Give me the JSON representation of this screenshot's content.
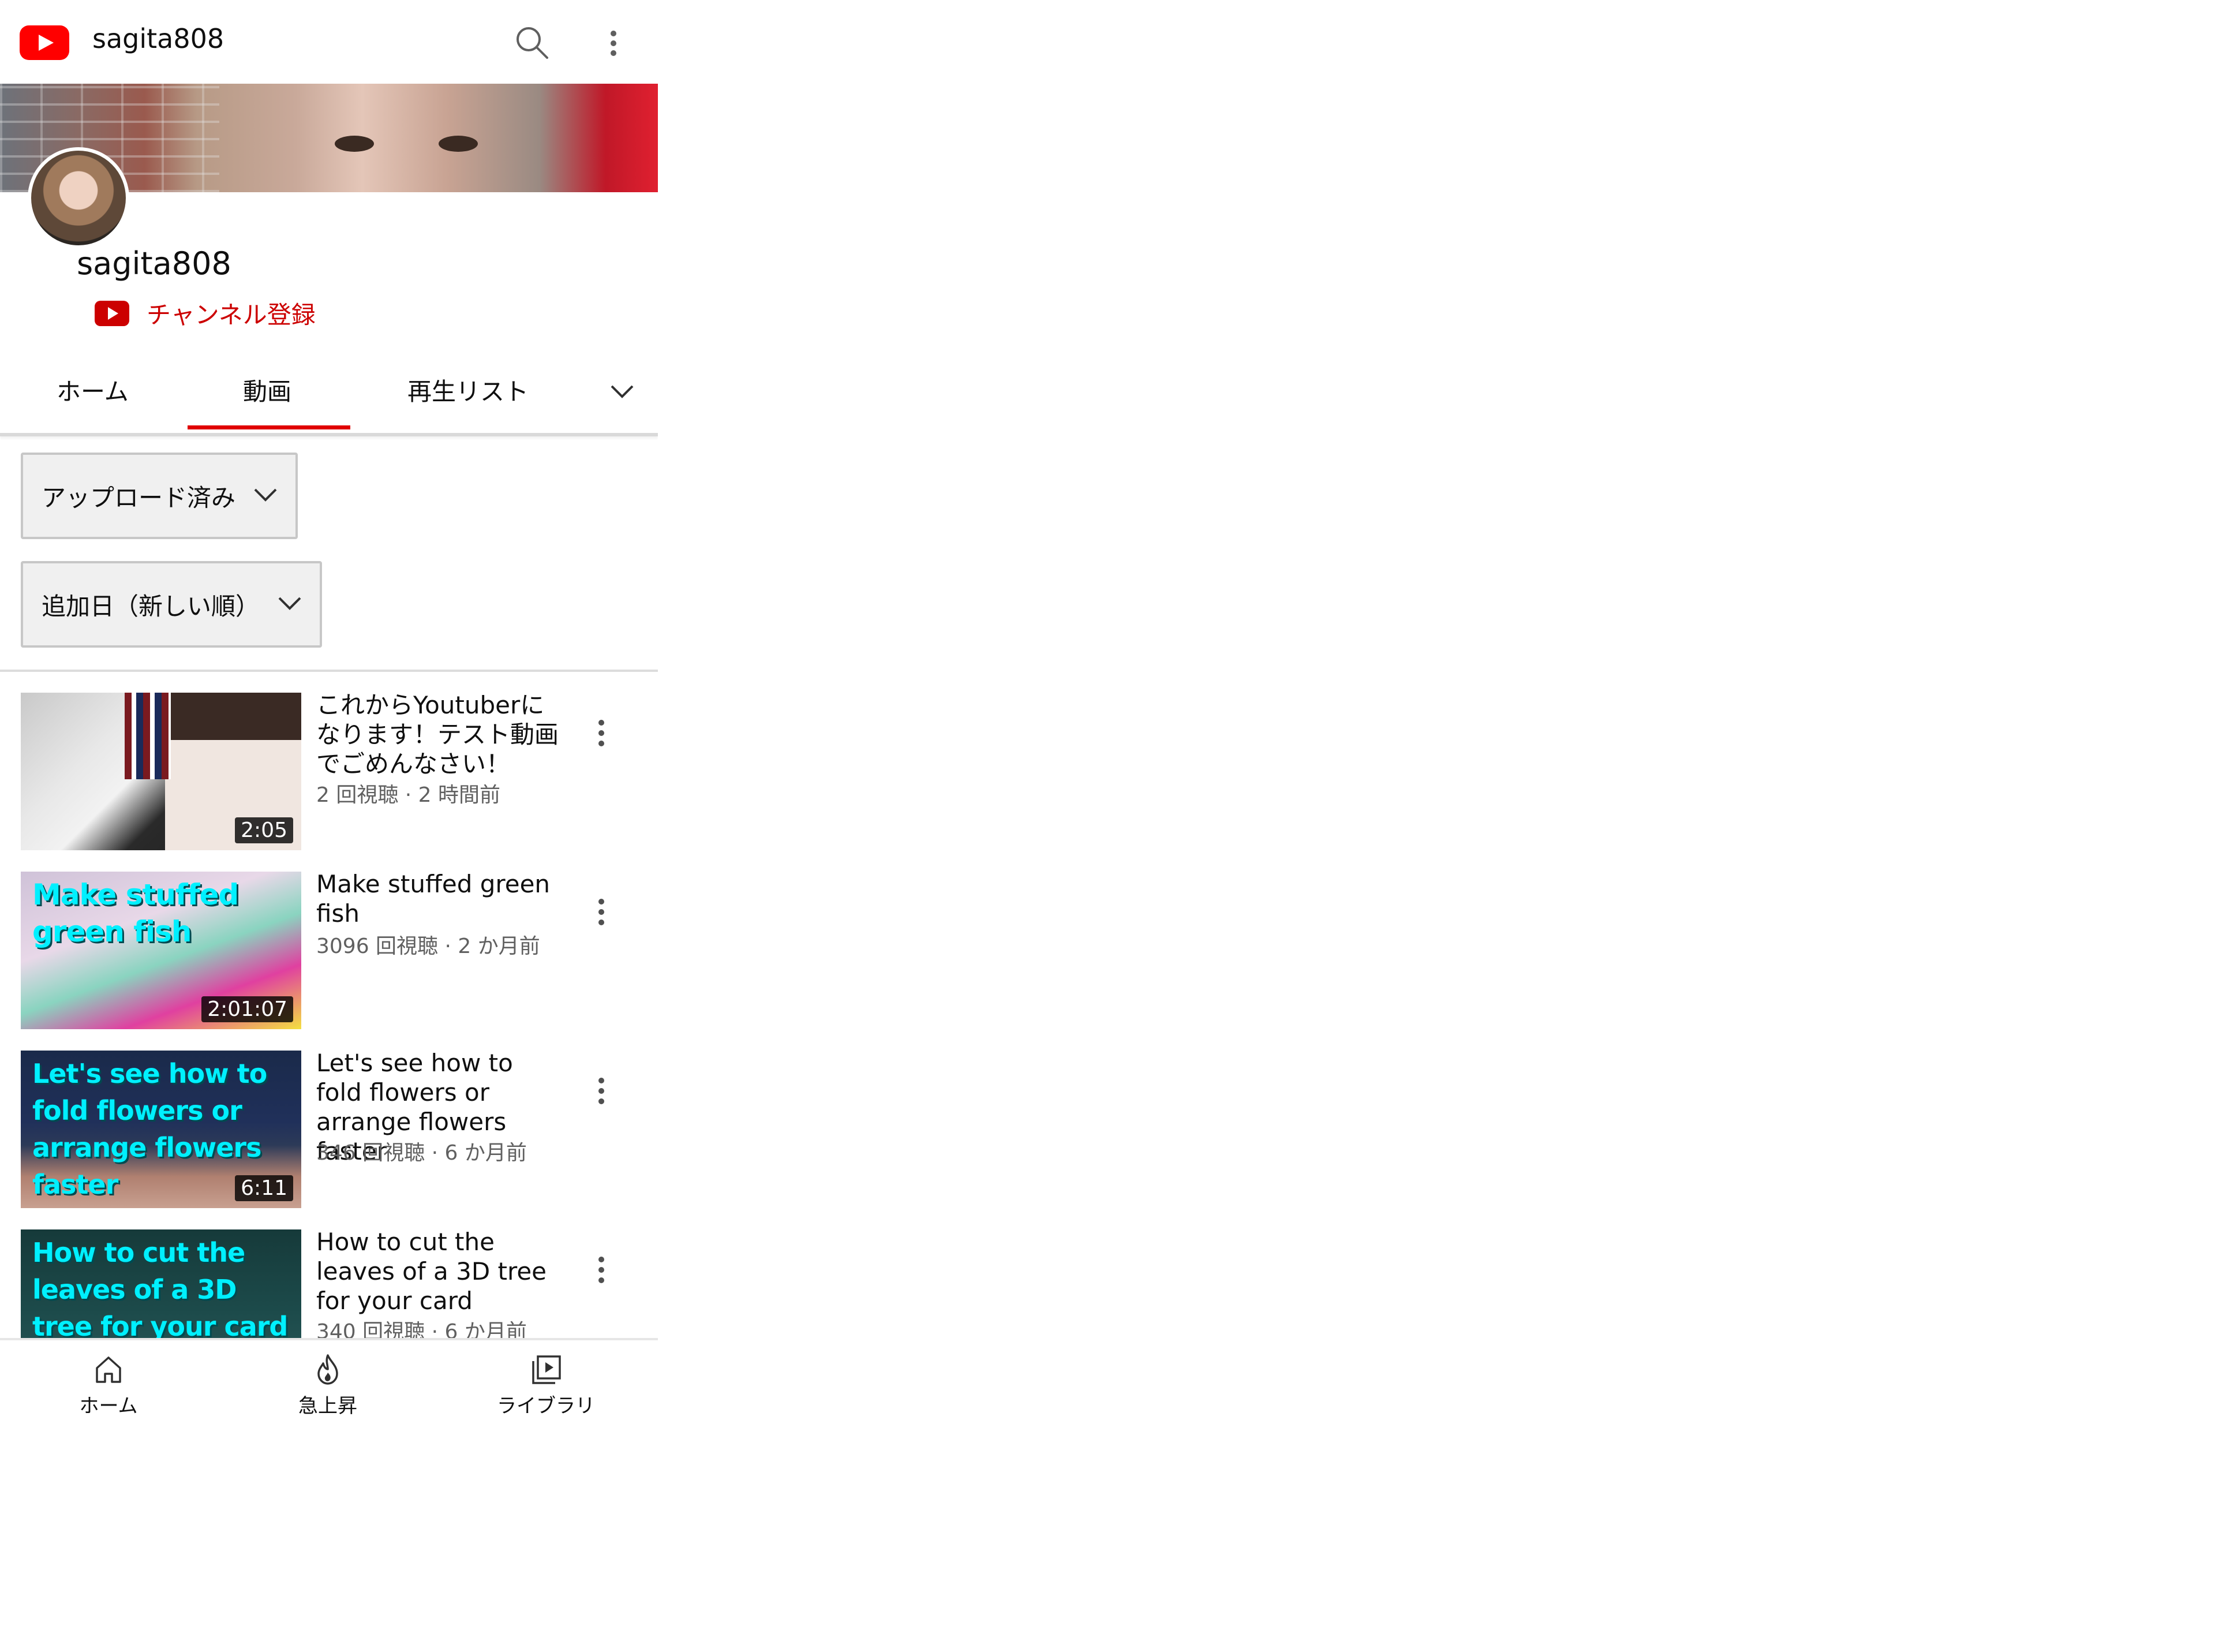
{
  "topbar": {
    "title": "sagita808"
  },
  "channel": {
    "name": "sagita808",
    "subscribe_label": "チャンネル登録"
  },
  "tabs": [
    {
      "label": "ホーム",
      "active": false
    },
    {
      "label": "動画",
      "active": true
    },
    {
      "label": "再生リスト",
      "active": false
    }
  ],
  "filters": {
    "type": "アップロード済み",
    "sort": "追加日（新しい順）"
  },
  "videos": [
    {
      "title": "これからYoutuberになります！テスト動画でごめんなさい！",
      "meta": "2 回視聴 · 2 時間前",
      "duration": "2:05",
      "thumb_caption": ""
    },
    {
      "title": "Make stuffed green fish",
      "meta": "3096 回視聴 · 2 か月前",
      "duration": "2:01:07",
      "thumb_caption": "Make stuffed green fish"
    },
    {
      "title": "Let's see how to fold flowers or arrange flowers faster",
      "meta": "346 回視聴 · 6 か月前",
      "duration": "6:11",
      "thumb_caption": "Let's see how to fold flowers or arrange flowers faster"
    },
    {
      "title": "How to cut the leaves of a 3D tree for your card",
      "meta": "340 回視聴 · 6 か月前",
      "duration": "",
      "thumb_caption": "How to cut the leaves of a 3D tree for your card"
    }
  ],
  "bottom_nav": [
    {
      "label": "ホーム",
      "icon": "home-icon"
    },
    {
      "label": "急上昇",
      "icon": "trending-flame-icon"
    },
    {
      "label": "ライブラリ",
      "icon": "library-icon"
    }
  ],
  "colors": {
    "brand_red": "#ff0000",
    "subscribe_red": "#cc0000",
    "meta_gray": "#606060"
  }
}
